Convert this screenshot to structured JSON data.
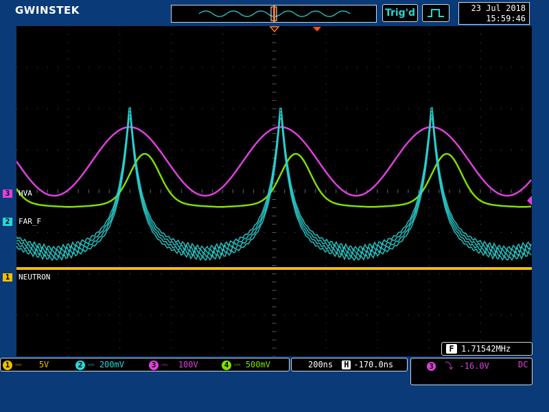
{
  "header": {
    "logo": "GWINSTEK",
    "trigger_status": "Trig'd",
    "date": "23 Jul 2018",
    "time": "15:59:46",
    "trigger_edge_icon": "rising-pulse-icon"
  },
  "channel_labels": [
    {
      "id": "3",
      "name": "HVA",
      "color": "#e040e0"
    },
    {
      "id": "2",
      "name": "FAR_F",
      "color": "#2ad6d6"
    },
    {
      "id": "1",
      "name": "NEUTRON",
      "color": "#f0c000"
    }
  ],
  "frequency": {
    "icon": "F",
    "value": "1.71542MHz"
  },
  "scales": [
    {
      "id": "1",
      "coupling": "DC",
      "value": "5V",
      "color": "#f0c000"
    },
    {
      "id": "2",
      "coupling": "DC",
      "value": "200mV",
      "color": "#2ad6d6"
    },
    {
      "id": "3",
      "coupling": "DC",
      "value": "100V",
      "color": "#e040e0"
    },
    {
      "id": "4",
      "coupling": "DC",
      "value": "500mV",
      "color": "#7fe000"
    }
  ],
  "timebase": {
    "scale": "200ns",
    "icon": "H",
    "position": "-170.0ns"
  },
  "trigger": {
    "source": "3",
    "slope_icon": "falling-edge-icon",
    "level": "-16.0V",
    "coupling": "DC"
  },
  "colors": {
    "ch1": "#f0c000",
    "ch2": "#2ad6d6",
    "ch3": "#e040e0",
    "ch4": "#7fe000",
    "grid": "#5a5a5a"
  }
}
